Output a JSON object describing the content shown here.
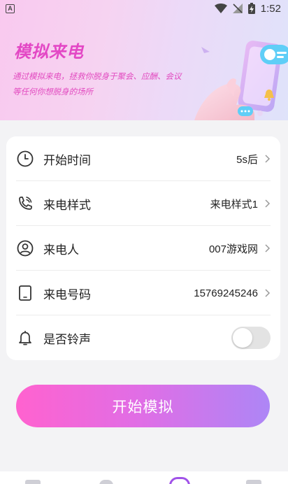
{
  "status_bar": {
    "time": "1:52",
    "notification_icon": "A"
  },
  "hero": {
    "title": "模拟来电",
    "description_line1": "通过模拟来电，拯救你脱身于聚会、应酬、会议",
    "description_line2": "等任何你想脱身的场所"
  },
  "settings": {
    "rows": [
      {
        "label": "开始时间",
        "value": "5s后",
        "icon": "clock-icon"
      },
      {
        "label": "来电样式",
        "value": "来电样式1",
        "icon": "phone-ringing-icon"
      },
      {
        "label": "来电人",
        "value": "007游戏网",
        "icon": "person-icon"
      },
      {
        "label": "来电号码",
        "value": "15769245246",
        "icon": "tablet-icon"
      }
    ],
    "ringtone": {
      "label": "是否铃声",
      "enabled": false,
      "icon": "bell-icon"
    }
  },
  "actions": {
    "start_label": "开始模拟"
  },
  "colors": {
    "accent_pink": "#e348c5",
    "button_start": "#ff62cf",
    "button_end": "#ad86f6"
  }
}
